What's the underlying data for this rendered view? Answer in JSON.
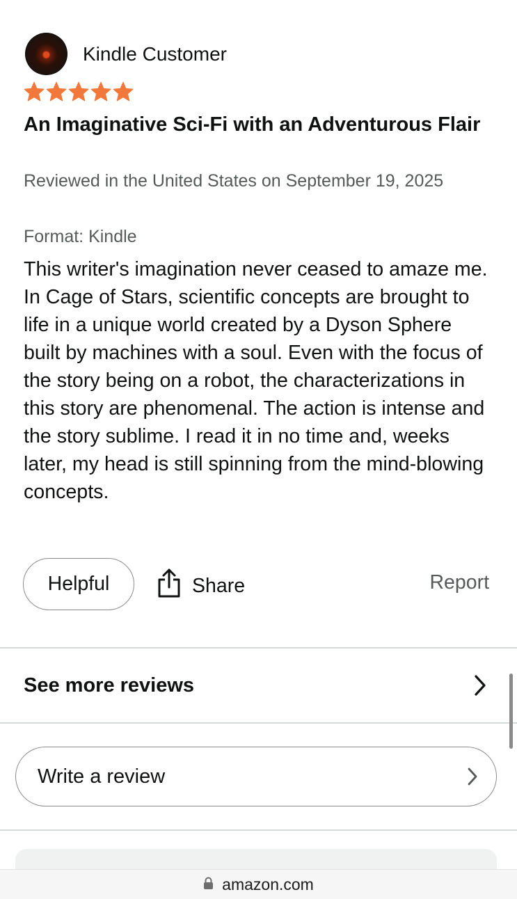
{
  "review": {
    "reviewer_name": "Kindle Customer",
    "rating": 5,
    "rating_max": 5,
    "star_color": "#f1783a",
    "title": "An Imaginative Sci-Fi with an Adventurous Flair",
    "date_line": "Reviewed in the United States on September 19, 2025",
    "format_line": "Format: Kindle",
    "body": "This writer's imagination never ceased to amaze me. In Cage of Stars, scientific concepts are brought to life in a unique world created by a Dyson Sphere built by machines with a soul. Even with the focus of the story being on a robot, the characterizations in this story are phenomenal. The action is intense and the story sublime. I read it in no time and, weeks later, my head is still spinning from the mind-blowing concepts."
  },
  "actions": {
    "helpful_label": "Helpful",
    "share_label": "Share",
    "report_label": "Report"
  },
  "see_more": {
    "label": "See more reviews"
  },
  "write_review": {
    "label": "Write a review"
  },
  "browser": {
    "address": "amazon.com",
    "icons": {
      "lock": "lock-icon",
      "share": "share-icon",
      "chevron": "chevron-right-icon"
    }
  }
}
